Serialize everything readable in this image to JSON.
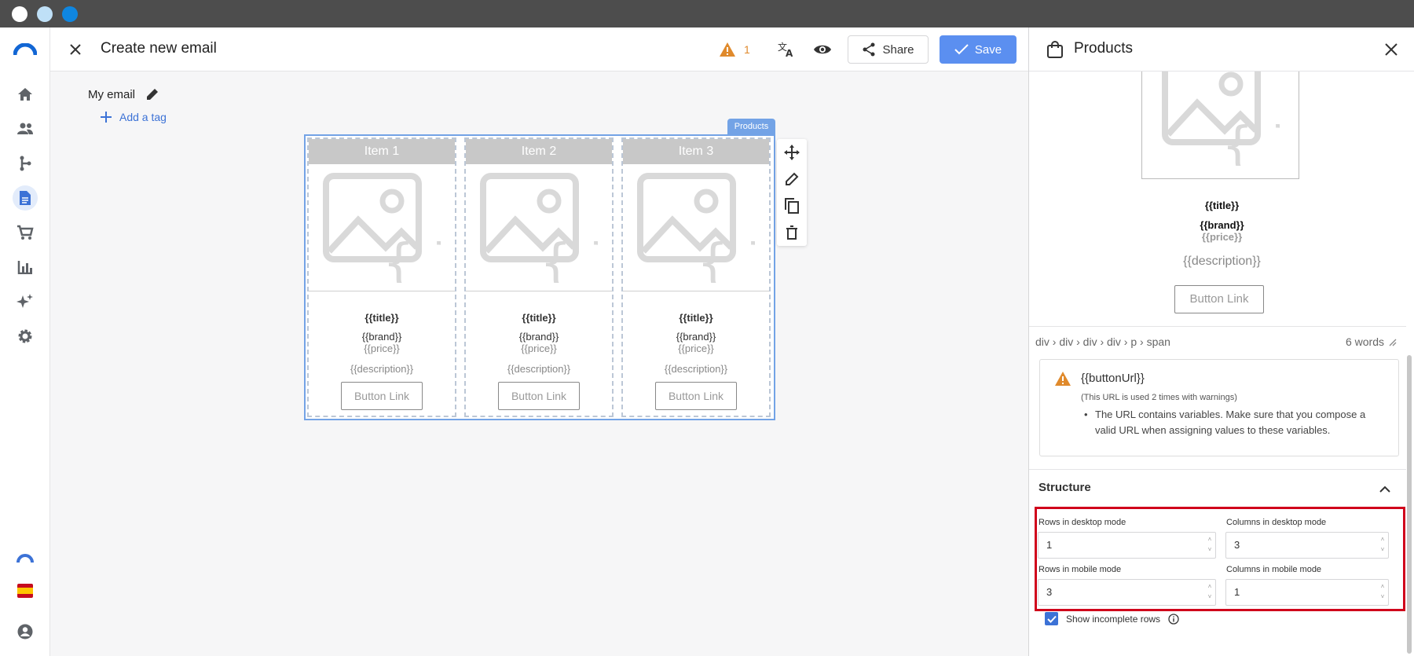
{
  "window": {
    "dot_colors": [
      "#ffffff",
      "#bfe0f7",
      "#0f86e0"
    ]
  },
  "rail": {
    "items": [
      {
        "icon": "logo-icon"
      },
      {
        "icon": "home-icon"
      },
      {
        "icon": "contacts-icon"
      },
      {
        "icon": "flow-icon"
      },
      {
        "icon": "document-icon",
        "active": true
      },
      {
        "icon": "cart-icon"
      },
      {
        "icon": "chart-icon"
      },
      {
        "icon": "sparkle-icon"
      },
      {
        "icon": "settings-icon"
      },
      {
        "icon": "brand-icon"
      },
      {
        "icon": "flag-es-icon"
      },
      {
        "icon": "user-icon"
      }
    ]
  },
  "header": {
    "title": "Create new email",
    "warning_count": "1",
    "share_label": "Share",
    "save_label": "Save"
  },
  "editor": {
    "email_name": "My email",
    "add_tag_label": "Add a tag",
    "block_label": "Products",
    "items": [
      {
        "header": "Item 1",
        "title": "{{title}}",
        "brand": "{{brand}}",
        "price": "{{price}}",
        "description": "{{description}}",
        "button": "Button Link"
      },
      {
        "header": "Item 2",
        "title": "{{title}}",
        "brand": "{{brand}}",
        "price": "{{price}}",
        "description": "{{description}}",
        "button": "Button Link"
      },
      {
        "header": "Item 3",
        "title": "{{title}}",
        "brand": "{{brand}}",
        "price": "{{price}}",
        "description": "{{description}}",
        "button": "Button Link"
      }
    ]
  },
  "panel": {
    "title": "Products",
    "preview": {
      "title": "{{title}}",
      "brand": "{{brand}}",
      "price": "{{price}}",
      "description": "{{description}}",
      "button": "Button Link"
    },
    "breadcrumb": "div › div › div › div › p › span",
    "word_count": "6 words",
    "warning": {
      "heading": "{{buttonUrl}}",
      "sub": "(This URL is used 2 times with warnings)",
      "message": "The URL contains variables. Make sure that you compose a valid URL when assigning values to these variables."
    },
    "structure": {
      "title": "Structure",
      "rows_desktop_label": "Rows in desktop mode",
      "rows_desktop_value": "1",
      "cols_desktop_label": "Columns in desktop mode",
      "cols_desktop_value": "3",
      "rows_mobile_label": "Rows in mobile mode",
      "rows_mobile_value": "3",
      "cols_mobile_label": "Columns in mobile mode",
      "cols_mobile_value": "1",
      "incomplete_label": "Show incomplete rows",
      "incomplete_checked": true
    }
  },
  "colors": {
    "accent": "#5b8ff0",
    "link": "#3c72d6",
    "warning": "#e08a2c",
    "highlight": "#d0021b",
    "selection": "#73a3e6"
  }
}
